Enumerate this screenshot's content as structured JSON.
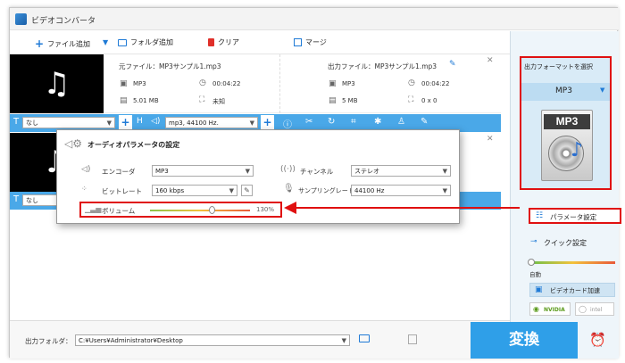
{
  "title": "ビデオコンバータ",
  "toolbar": {
    "add_file": "ファイル追加",
    "add_folder": "フォルダ追加",
    "clear": "クリア",
    "merge": "マージ"
  },
  "file1": {
    "source_label": "元ファイル：MP3サンプル1.mp3",
    "source_format": "MP3",
    "source_duration": "00:04:22",
    "source_size": "5.01 MB",
    "source_resolution": "未知",
    "output_label": "出力ファイル：MP3サンプル1.mp3",
    "output_format": "MP3",
    "output_duration": "00:04:22",
    "output_size": "5 MB",
    "output_resolution": "0 x 0"
  },
  "bar1": {
    "subtitle": "なし",
    "audio": "mp3, 44100 Hz."
  },
  "bar2": {
    "subtitle": "なし"
  },
  "dialog": {
    "title": "オーディオパラメータの設定",
    "encoder_label": "エンコーダ",
    "encoder_value": "MP3",
    "channel_label": "チャンネル",
    "channel_value": "ステレオ",
    "bitrate_label": "ビットレート",
    "bitrate_value": "160 kbps",
    "samplerate_label": "サンプリングレート",
    "samplerate_value": "44100 Hz",
    "volume_label": "ボリューム",
    "volume_value": "130%",
    "volume_level": 0.62
  },
  "right": {
    "output_format_title": "出力フォーマットを選択",
    "format": "MP3",
    "format_icon_text": "MP3",
    "param_settings": "パラメータ設定",
    "quick_settings": "クイック設定",
    "auto": "自動",
    "gpu_accel": "ビデオカード加速",
    "nvidia": "NVIDIA",
    "intel": "intel"
  },
  "footer": {
    "output_folder_label": "出力フォルダ：",
    "output_folder_path": "C:¥Users¥Administrator¥Desktop",
    "convert": "変換"
  },
  "colors": {
    "accent": "#4aa8e8",
    "convert_bg": "#2f9fe8",
    "highlight": "#e01010"
  }
}
